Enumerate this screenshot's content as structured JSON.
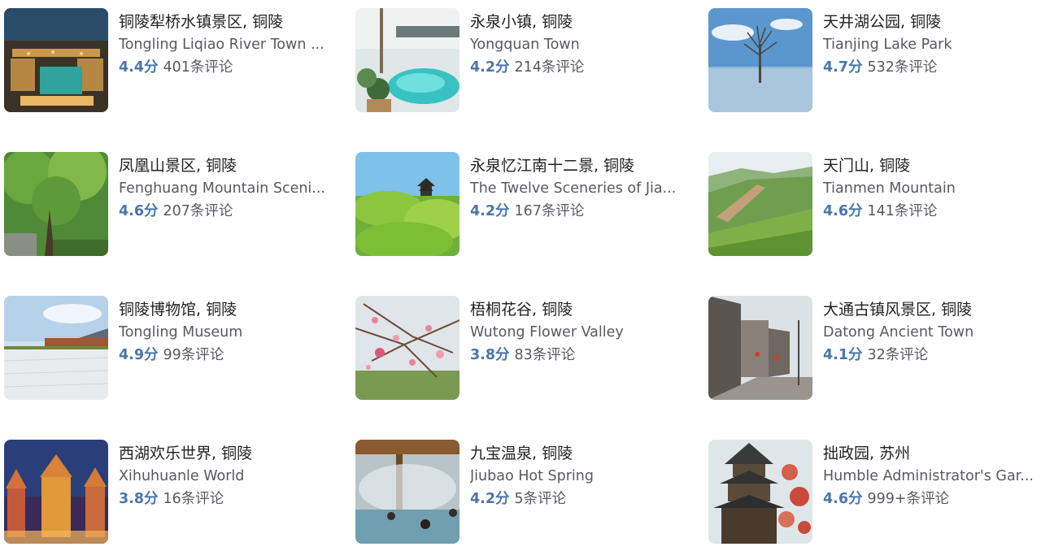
{
  "colors": {
    "score": "#4a76ab",
    "title": "#222222",
    "subtitle": "#555a60"
  },
  "cards": [
    {
      "title": "铜陵犁桥水镇景区, 铜陵",
      "subtitle": "Tongling Liqiao River Town ...",
      "score": "4.4分",
      "reviews": "401条评论",
      "image": "night-water-town"
    },
    {
      "title": "永泉小镇, 铜陵",
      "subtitle": "Yongquan Town",
      "score": "4.2分",
      "reviews": "214条评论",
      "image": "hot-spring-pool"
    },
    {
      "title": "天井湖公园, 铜陵",
      "subtitle": "Tianjing Lake Park",
      "score": "4.7分",
      "reviews": "532条评论",
      "image": "lake-tree"
    },
    {
      "title": "凤凰山景区, 铜陵",
      "subtitle": "Fenghuang Mountain Sceni...",
      "score": "4.6分",
      "reviews": "207条评论",
      "image": "green-forest"
    },
    {
      "title": "永泉忆江南十二景, 铜陵",
      "subtitle": "The Twelve Sceneries of Jia...",
      "score": "4.2分",
      "reviews": "167条评论",
      "image": "pavilion-hill"
    },
    {
      "title": "天门山, 铜陵",
      "subtitle": "Tianmen Mountain",
      "score": "4.6分",
      "reviews": "141条评论",
      "image": "green-mountain"
    },
    {
      "title": "铜陵博物馆, 铜陵",
      "subtitle": "Tongling Museum",
      "score": "4.9分",
      "reviews": "99条评论",
      "image": "museum-plaza"
    },
    {
      "title": "梧桐花谷, 铜陵",
      "subtitle": "Wutong Flower Valley",
      "score": "3.8分",
      "reviews": "83条评论",
      "image": "peach-blossom"
    },
    {
      "title": "大通古镇风景区, 铜陵",
      "subtitle": "Datong Ancient Town",
      "score": "4.1分",
      "reviews": "32条评论",
      "image": "ancient-street"
    },
    {
      "title": "西湖欢乐世界, 铜陵",
      "subtitle": "Xihuhuanle World",
      "score": "3.8分",
      "reviews": "16条评论",
      "image": "castle-night"
    },
    {
      "title": "九宝温泉, 铜陵",
      "subtitle": "Jiubao Hot Spring",
      "score": "4.2分",
      "reviews": "5条评论",
      "image": "steamy-spring"
    },
    {
      "title": "拙政园, 苏州",
      "subtitle": "Humble Administrator's Gar...",
      "score": "4.6分",
      "reviews": "999+条评论",
      "image": "garden-pavilion"
    }
  ]
}
